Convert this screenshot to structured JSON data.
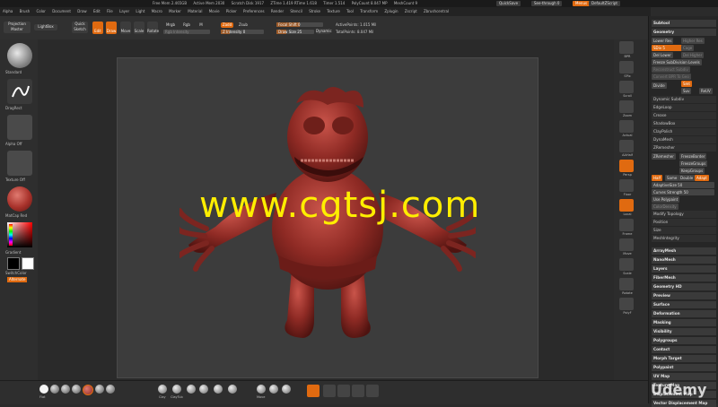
{
  "titlebar": {
    "items": [
      "Free Mem 2.465GB",
      "Active Mem 2030",
      "Scratch Disk 1917",
      "ZTime 1.419 RTime 1.618",
      "Timer 1.514",
      "PolyCount 8.047 MP",
      "MeshCount 9"
    ],
    "quicksave": "QuickSave",
    "seethrough": "See-through 0",
    "menus": "Menus",
    "script": "DefaultZScript"
  },
  "menubar": [
    "Alpha",
    "Brush",
    "Color",
    "Document",
    "Draw",
    "Edit",
    "File",
    "Layer",
    "Light",
    "Macro",
    "Marker",
    "Material",
    "Movie",
    "Picker",
    "Preferences",
    "Render",
    "Stencil",
    "Stroke",
    "Texture",
    "Tool",
    "Transform",
    "Zplugin",
    "Zscript",
    "Zbrushcentral"
  ],
  "toptool": {
    "projection": "Projection Master",
    "lightbox": "LightBox",
    "quicksketch": "Quick Sketch",
    "edit": "Edit",
    "draw": "Draw",
    "move": "Move",
    "scale": "Scale",
    "rotate": "Rotate",
    "mrgb": "Mrgb",
    "rgb": "Rgb",
    "m": "M",
    "rgb_intensity": "Rgb Intensity",
    "zadd": "Zadd",
    "zsub": "Zsub",
    "zintensity": "Z Intensity 0",
    "focal": "Focal Shift 0",
    "drawsize": "Draw Size 25",
    "dynamic": "Dynamic",
    "activepoints": "ActivePoints: 1.015 Mil",
    "totalpoints": "TotalPoints: 8.047 Mil"
  },
  "leftshelf": {
    "label_standard": "Standard",
    "label_dragrect": "DragRect",
    "label_alpha": "Alpha Off",
    "label_texture": "Texture Off",
    "label_material": "MatCap Red",
    "gradient": "Gradient",
    "switchcolor": "SwitchColor",
    "alternate": "Alternate"
  },
  "rightshelf": [
    "BPR",
    "SPix",
    "Scroll",
    "Zoom",
    "Actual",
    "AAHalf",
    "Persp",
    "Floor",
    "Local",
    "LSym",
    "Frame",
    "Move",
    "Scale",
    "Rotate",
    "Line Fill",
    "PolyF",
    "Transp",
    "Ghost",
    "Solo",
    "Xpose"
  ],
  "tray": {
    "subtool": "Subtool",
    "geometry": "Geometry",
    "lower_res": "Lower Res",
    "higher_res": "Higher Res",
    "sdiv": "SDiv 5",
    "cage": "Cage",
    "del_lower": "Del Lower",
    "del_higher": "Del Higher",
    "freeze": "Freeze SubDivision Levels",
    "reconstruct": "Reconstruct Subdiv",
    "convert": "Convert BPR To Geo",
    "divide": "Divide",
    "smt": "Smt",
    "suv": "Suv",
    "reuv": "ReUV",
    "dynamic_subdiv": "Dynamic Subdiv",
    "edgeloop": "EdgeLoop",
    "crease": "Crease",
    "shadowbox": "ShadowBox",
    "claypolish": "ClayPolish",
    "dynamesh": "DynaMesh",
    "zremesher": "ZRemesher",
    "freezeborder": "FreezeBorder",
    "freezegroups": "FreezeGroups",
    "keepgroups": "KeepGroups",
    "half": "Half",
    "same": "Same",
    "double": "Double",
    "adapt": "Adapt",
    "adaptivesize": "AdaptiveSize 50",
    "curvesstrength": "Curves Strength 50",
    "usepolypaint": "Use Polypaint",
    "colordensity": "ColorDensity",
    "modifytopology": "Modify Topology",
    "position": "Position",
    "size": "Size",
    "meshintegrity": "MeshIntegrity",
    "sections": [
      "ArrayMesh",
      "NanoMesh",
      "Layers",
      "FiberMesh",
      "Geometry HD",
      "Preview",
      "Surface",
      "Deformation",
      "Masking",
      "Visibility",
      "Polygroups",
      "Contact",
      "Morph Target",
      "Polypaint",
      "UV Map",
      "Texture Map",
      "Displacement Map",
      "Vector Displacement Map"
    ]
  },
  "bottomshelf": {
    "materials": [
      "Flat",
      "Cut Pen",
      "Dam_Standard",
      "MatCap",
      "Basic Mat",
      "TooPlus"
    ],
    "brushes": [
      "Clay",
      "ClayTub",
      "Standard",
      "TrimDyn",
      "Inflat",
      "Dam_St",
      "ClayBuild",
      "Move",
      "Move T",
      "Snakehook"
    ],
    "tools": [
      "Del",
      "Pinch",
      "Split",
      "Scale",
      "Group"
    ]
  },
  "watermark": "www.cgtsj.com",
  "udemy": "Udemy",
  "colors": {
    "accent": "#e06a10",
    "material_red": "#a8322b",
    "watermark": "#ffee00"
  }
}
